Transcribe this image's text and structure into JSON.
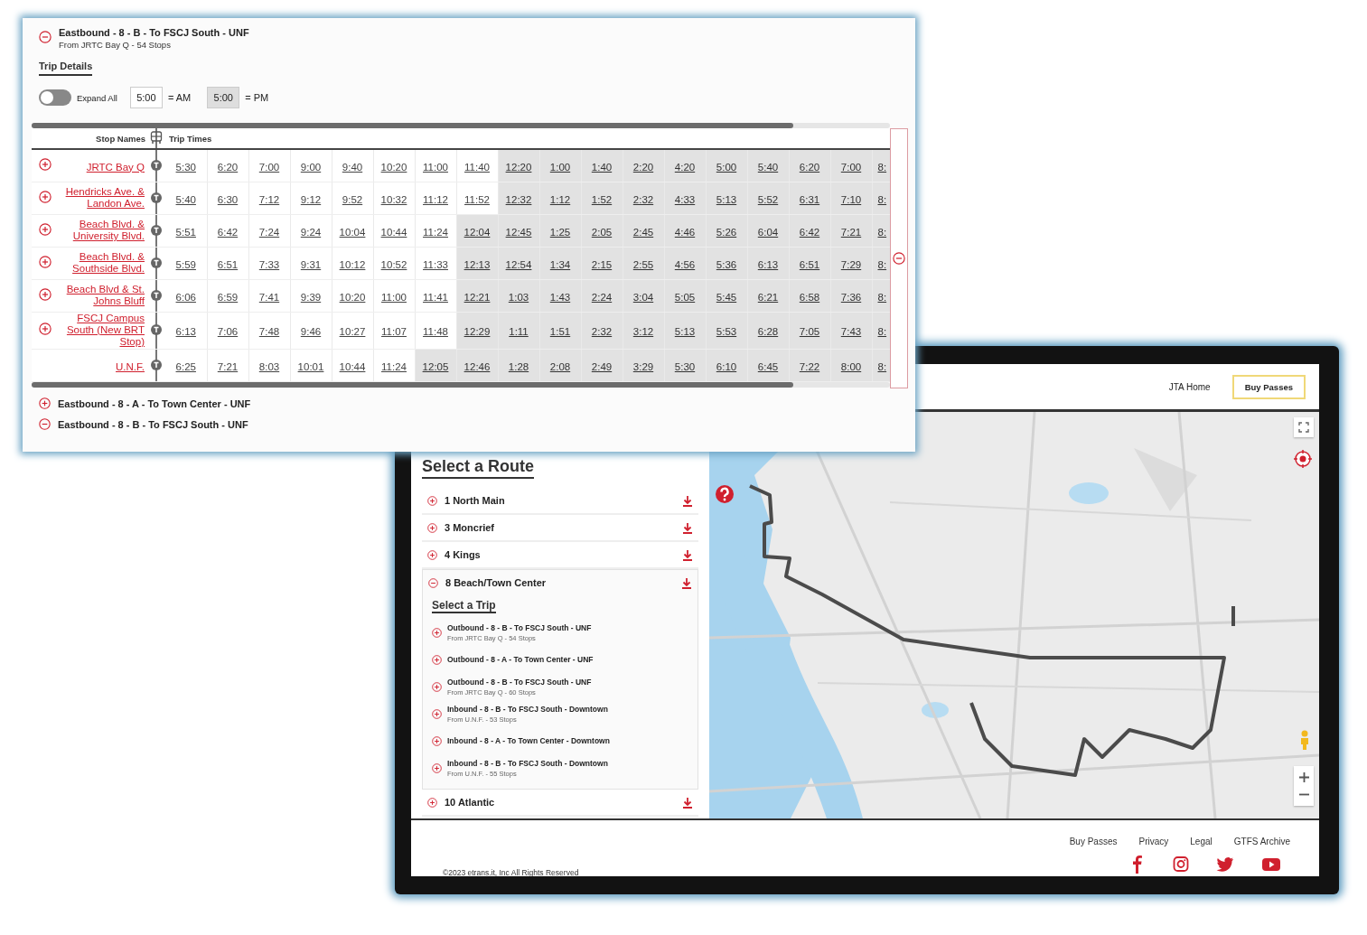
{
  "trip_panel": {
    "title": "Eastbound - 8 - B - To FSCJ South - UNF",
    "subtitle": "From JRTC Bay Q - 54 Stops",
    "expanded": true,
    "tab_label": "Trip Details",
    "expand_all": {
      "label": "Expand All",
      "on": false
    },
    "legend": [
      {
        "time": "5:00",
        "label": "= AM",
        "pm": false
      },
      {
        "time": "5:00",
        "label": "= PM",
        "pm": true
      }
    ],
    "table": {
      "columns": [
        "Stop Names",
        "Trip Times"
      ],
      "rows": [
        {
          "stop": "JRTC Bay Q",
          "expandable": true,
          "times": [
            {
              "t": "5:30",
              "pm": false
            },
            {
              "t": "6:20",
              "pm": false
            },
            {
              "t": "7:00",
              "pm": false
            },
            {
              "t": "9:00",
              "pm": false
            },
            {
              "t": "9:40",
              "pm": false
            },
            {
              "t": "10:20",
              "pm": false
            },
            {
              "t": "11:00",
              "pm": false
            },
            {
              "t": "11:40",
              "pm": false
            },
            {
              "t": "12:20",
              "pm": true
            },
            {
              "t": "1:00",
              "pm": true
            },
            {
              "t": "1:40",
              "pm": true
            },
            {
              "t": "2:20",
              "pm": true
            },
            {
              "t": "4:20",
              "pm": true
            },
            {
              "t": "5:00",
              "pm": true
            },
            {
              "t": "5:40",
              "pm": true
            },
            {
              "t": "6:20",
              "pm": true
            },
            {
              "t": "7:00",
              "pm": true
            },
            {
              "t": "8:",
              "pm": true
            }
          ]
        },
        {
          "stop": "Hendricks Ave. & Landon Ave.",
          "expandable": true,
          "times": [
            {
              "t": "5:40",
              "pm": false
            },
            {
              "t": "6:30",
              "pm": false
            },
            {
              "t": "7:12",
              "pm": false
            },
            {
              "t": "9:12",
              "pm": false
            },
            {
              "t": "9:52",
              "pm": false
            },
            {
              "t": "10:32",
              "pm": false
            },
            {
              "t": "11:12",
              "pm": false
            },
            {
              "t": "11:52",
              "pm": false
            },
            {
              "t": "12:32",
              "pm": true
            },
            {
              "t": "1:12",
              "pm": true
            },
            {
              "t": "1:52",
              "pm": true
            },
            {
              "t": "2:32",
              "pm": true
            },
            {
              "t": "4:33",
              "pm": true
            },
            {
              "t": "5:13",
              "pm": true
            },
            {
              "t": "5:52",
              "pm": true
            },
            {
              "t": "6:31",
              "pm": true
            },
            {
              "t": "7:10",
              "pm": true
            },
            {
              "t": "8:",
              "pm": true
            }
          ]
        },
        {
          "stop": "Beach Blvd. & University Blvd.",
          "expandable": true,
          "times": [
            {
              "t": "5:51",
              "pm": false
            },
            {
              "t": "6:42",
              "pm": false
            },
            {
              "t": "7:24",
              "pm": false
            },
            {
              "t": "9:24",
              "pm": false
            },
            {
              "t": "10:04",
              "pm": false
            },
            {
              "t": "10:44",
              "pm": false
            },
            {
              "t": "11:24",
              "pm": false
            },
            {
              "t": "12:04",
              "pm": true
            },
            {
              "t": "12:45",
              "pm": true
            },
            {
              "t": "1:25",
              "pm": true
            },
            {
              "t": "2:05",
              "pm": true
            },
            {
              "t": "2:45",
              "pm": true
            },
            {
              "t": "4:46",
              "pm": true
            },
            {
              "t": "5:26",
              "pm": true
            },
            {
              "t": "6:04",
              "pm": true
            },
            {
              "t": "6:42",
              "pm": true
            },
            {
              "t": "7:21",
              "pm": true
            },
            {
              "t": "8:",
              "pm": true
            }
          ]
        },
        {
          "stop": "Beach Blvd. & Southside Blvd.",
          "expandable": true,
          "times": [
            {
              "t": "5:59",
              "pm": false
            },
            {
              "t": "6:51",
              "pm": false
            },
            {
              "t": "7:33",
              "pm": false
            },
            {
              "t": "9:31",
              "pm": false
            },
            {
              "t": "10:12",
              "pm": false
            },
            {
              "t": "10:52",
              "pm": false
            },
            {
              "t": "11:33",
              "pm": false
            },
            {
              "t": "12:13",
              "pm": true
            },
            {
              "t": "12:54",
              "pm": true
            },
            {
              "t": "1:34",
              "pm": true
            },
            {
              "t": "2:15",
              "pm": true
            },
            {
              "t": "2:55",
              "pm": true
            },
            {
              "t": "4:56",
              "pm": true
            },
            {
              "t": "5:36",
              "pm": true
            },
            {
              "t": "6:13",
              "pm": true
            },
            {
              "t": "6:51",
              "pm": true
            },
            {
              "t": "7:29",
              "pm": true
            },
            {
              "t": "8:",
              "pm": true
            }
          ]
        },
        {
          "stop": "Beach Blvd & St. Johns Bluff",
          "expandable": true,
          "times": [
            {
              "t": "6:06",
              "pm": false
            },
            {
              "t": "6:59",
              "pm": false
            },
            {
              "t": "7:41",
              "pm": false
            },
            {
              "t": "9:39",
              "pm": false
            },
            {
              "t": "10:20",
              "pm": false
            },
            {
              "t": "11:00",
              "pm": false
            },
            {
              "t": "11:41",
              "pm": false
            },
            {
              "t": "12:21",
              "pm": true
            },
            {
              "t": "1:03",
              "pm": true
            },
            {
              "t": "1:43",
              "pm": true
            },
            {
              "t": "2:24",
              "pm": true
            },
            {
              "t": "3:04",
              "pm": true
            },
            {
              "t": "5:05",
              "pm": true
            },
            {
              "t": "5:45",
              "pm": true
            },
            {
              "t": "6:21",
              "pm": true
            },
            {
              "t": "6:58",
              "pm": true
            },
            {
              "t": "7:36",
              "pm": true
            },
            {
              "t": "8:",
              "pm": true
            }
          ]
        },
        {
          "stop": "FSCJ Campus South (New BRT Stop)",
          "expandable": true,
          "times": [
            {
              "t": "6:13",
              "pm": false
            },
            {
              "t": "7:06",
              "pm": false
            },
            {
              "t": "7:48",
              "pm": false
            },
            {
              "t": "9:46",
              "pm": false
            },
            {
              "t": "10:27",
              "pm": false
            },
            {
              "t": "11:07",
              "pm": false
            },
            {
              "t": "11:48",
              "pm": false
            },
            {
              "t": "12:29",
              "pm": true
            },
            {
              "t": "1:11",
              "pm": true
            },
            {
              "t": "1:51",
              "pm": true
            },
            {
              "t": "2:32",
              "pm": true
            },
            {
              "t": "3:12",
              "pm": true
            },
            {
              "t": "5:13",
              "pm": true
            },
            {
              "t": "5:53",
              "pm": true
            },
            {
              "t": "6:28",
              "pm": true
            },
            {
              "t": "7:05",
              "pm": true
            },
            {
              "t": "7:43",
              "pm": true
            },
            {
              "t": "8:",
              "pm": true
            }
          ]
        },
        {
          "stop": "U.N.F.",
          "expandable": false,
          "times": [
            {
              "t": "6:25",
              "pm": false
            },
            {
              "t": "7:21",
              "pm": false
            },
            {
              "t": "8:03",
              "pm": false
            },
            {
              "t": "10:01",
              "pm": false
            },
            {
              "t": "10:44",
              "pm": false
            },
            {
              "t": "11:24",
              "pm": false
            },
            {
              "t": "12:05",
              "pm": true
            },
            {
              "t": "12:46",
              "pm": true
            },
            {
              "t": "1:28",
              "pm": true
            },
            {
              "t": "2:08",
              "pm": true
            },
            {
              "t": "2:49",
              "pm": true
            },
            {
              "t": "3:29",
              "pm": true
            },
            {
              "t": "5:30",
              "pm": true
            },
            {
              "t": "6:10",
              "pm": true
            },
            {
              "t": "6:45",
              "pm": true
            },
            {
              "t": "7:22",
              "pm": true
            },
            {
              "t": "8:00",
              "pm": true
            },
            {
              "t": "8:",
              "pm": true
            }
          ]
        }
      ]
    },
    "other_trips": [
      {
        "title": "Eastbound - 8 - A - To Town Center - UNF",
        "expanded": false
      },
      {
        "title": "Eastbound - 8 - B - To FSCJ South - UNF",
        "expanded": true
      }
    ]
  },
  "website": {
    "nav": [
      {
        "label": "JTA Home",
        "kind": "link"
      },
      {
        "label": "Buy Passes",
        "kind": "button"
      }
    ],
    "routes_heading": "Select a Route",
    "routes": [
      {
        "name": "1 North Main",
        "expanded": false
      },
      {
        "name": "3 Moncrief",
        "expanded": false
      },
      {
        "name": "4 Kings",
        "expanded": false
      },
      {
        "name": "8 Beach/Town Center",
        "expanded": true,
        "trips_heading": "Select a Trip",
        "trips": [
          {
            "title": "Outbound - 8 - B - To FSCJ South - UNF",
            "subtitle": "From JRTC Bay Q - 54 Stops",
            "expanded": false
          },
          {
            "title": "Outbound - 8 - A - To Town Center - UNF",
            "expanded": false
          },
          {
            "title": "Outbound - 8 - B - To FSCJ South - UNF",
            "subtitle": "From JRTC Bay Q - 60 Stops",
            "expanded": false
          },
          {
            "title": "Inbound - 8 - B - To FSCJ South - Downtown",
            "subtitle": "From U.N.F. - 53 Stops",
            "expanded": false
          },
          {
            "title": "Inbound - 8 - A - To Town Center - Downtown",
            "expanded": false
          },
          {
            "title": "Inbound - 8 - B - To FSCJ South - Downtown",
            "subtitle": "From U.N.F. - 55 Stops",
            "expanded": false
          }
        ]
      },
      {
        "name": "10 Atlantic",
        "expanded": false
      }
    ],
    "footer": {
      "links": [
        "Buy Passes",
        "Privacy",
        "Legal",
        "GTFS Archive"
      ],
      "copyright": "©2023 etrans.it, Inc All Rights Reserved"
    }
  }
}
